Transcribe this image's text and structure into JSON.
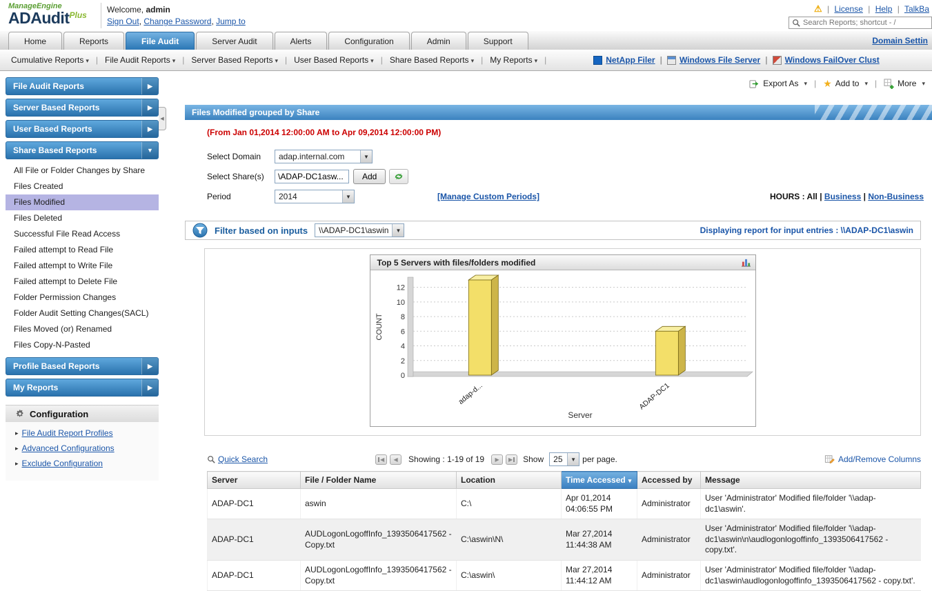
{
  "icons": {
    "warning": "⚠",
    "caret": "▾",
    "arrow_right": "▶",
    "arrow_down": "▼",
    "arrow_left": "◀",
    "bullet": "▸",
    "star": "★",
    "tri_left": "◀",
    "tri_right": "▶"
  },
  "ui": {
    "pipe": "|",
    "comma": ", "
  },
  "header": {
    "brand": "ManageEngine",
    "product": "ADAudit",
    "product_plus": "Plus",
    "welcome": "Welcome,",
    "username": "admin",
    "sign_out": "Sign Out",
    "change_password": "Change Password",
    "jump_to": "Jump to",
    "license": "License",
    "help": "Help",
    "talkback": "TalkBa",
    "search_placeholder": "Search Reports; shortcut - /"
  },
  "nav": {
    "tabs": [
      "Home",
      "Reports",
      "File Audit",
      "Server Audit",
      "Alerts",
      "Configuration",
      "Admin",
      "Support"
    ],
    "active": "File Audit",
    "domain_settings": "Domain Settin"
  },
  "subnav": {
    "menus": [
      "Cumulative Reports",
      "File Audit Reports",
      "Server Based Reports",
      "User Based Reports",
      "Share Based Reports",
      "My Reports"
    ],
    "netapp": "NetApp Filer",
    "windows_file_server": "Windows File Server",
    "failover_cluster": "Windows FailOver Clust"
  },
  "sidebar": {
    "groups": [
      "File Audit Reports",
      "Server Based Reports",
      "User Based Reports",
      "Share Based Reports"
    ],
    "share_items": [
      "All File or Folder Changes by Share",
      "Files Created",
      "Files Modified",
      "Files Deleted",
      "Successful File Read Access",
      "Failed attempt to Read File",
      "Failed attempt to Write File",
      "Failed attempt to Delete File",
      "Folder Permission Changes",
      "Folder Audit Setting Changes(SACL)",
      "Files Moved (or) Renamed",
      "Files Copy-N-Pasted"
    ],
    "selected": "Files Modified",
    "bottom_groups": [
      "Profile Based Reports",
      "My Reports"
    ],
    "config": {
      "title": "Configuration",
      "items": [
        "File Audit Report Profiles",
        "Advanced Configurations",
        "Exclude Configuration"
      ]
    }
  },
  "toolbar": {
    "export_as": "Export As",
    "add_to": "Add to",
    "more": "More"
  },
  "report": {
    "title": "Files Modified grouped by Share",
    "date_range": "(From Jan 01,2014 12:00:00 AM to Apr 09,2014 12:00:00 PM)",
    "select_domain": "Select Domain",
    "domain": "adap.internal.com",
    "select_shares": "Select Share(s)",
    "share": "\\ADAP-DC1asw...",
    "add": "Add",
    "period_label": "Period",
    "period": "2014",
    "manage_custom_periods": "[Manage Custom Periods]",
    "hours": "HOURS : All",
    "business": "Business",
    "non_business": "Non-Business"
  },
  "filter": {
    "label": "Filter based on inputs",
    "value": "\\\\ADAP-DC1\\aswin",
    "displaying": "Displaying report for input entries : \\\\ADAP-DC1\\aswin"
  },
  "chart_data": {
    "type": "bar",
    "title": "Top 5 Servers with files/folders modified",
    "categories": [
      "adap-d...",
      "ADAP-DC1"
    ],
    "values": [
      13,
      6
    ],
    "xlabel": "Server",
    "ylabel": "COUNT",
    "ylim": [
      0,
      13
    ],
    "yticks": [
      0,
      2,
      4,
      6,
      8,
      10,
      12
    ],
    "bar_color": "#f3df69",
    "bar_side_color": "#cdb549",
    "bar_top_color": "#f8efa3",
    "grid": true,
    "legend": false,
    "x_fractions": [
      0.2,
      0.76
    ]
  },
  "table": {
    "quick_search": "Quick Search",
    "showing": "Showing :  1-19 of 19",
    "show": "Show",
    "page_size": "25",
    "per_page": "per page.",
    "add_remove_columns": "Add/Remove Columns",
    "columns": [
      "Server",
      "File / Folder Name",
      "Location",
      "Time Accessed",
      "Accessed by",
      "Message"
    ],
    "sorted_column": "Time Accessed",
    "rows": [
      {
        "server": "ADAP-DC1",
        "file": "aswin",
        "location": "C:\\",
        "time": "Apr 01,2014 04:06:55 PM",
        "accessed_by": "Administrator",
        "message": "User 'Administrator' Modified file/folder '\\\\adap-dc1\\aswin'."
      },
      {
        "server": "ADAP-DC1",
        "file": "AUDLogonLogoffInfo_1393506417562 - Copy.txt",
        "location": "C:\\aswin\\N\\",
        "time": "Mar 27,2014 11:44:38 AM",
        "accessed_by": "Administrator",
        "message": "User 'Administrator' Modified file/folder '\\\\adap-dc1\\aswin\\n\\audlogonlogoffinfo_1393506417562 - copy.txt'."
      },
      {
        "server": "ADAP-DC1",
        "file": "AUDLogonLogoffInfo_1393506417562 - Copy.txt",
        "location": "C:\\aswin\\",
        "time": "Mar 27,2014 11:44:12 AM",
        "accessed_by": "Administrator",
        "message": "User 'Administrator' Modified file/folder '\\\\adap-dc1\\aswin\\audlogonlogoffinfo_1393506417562 - copy.txt'."
      }
    ]
  }
}
